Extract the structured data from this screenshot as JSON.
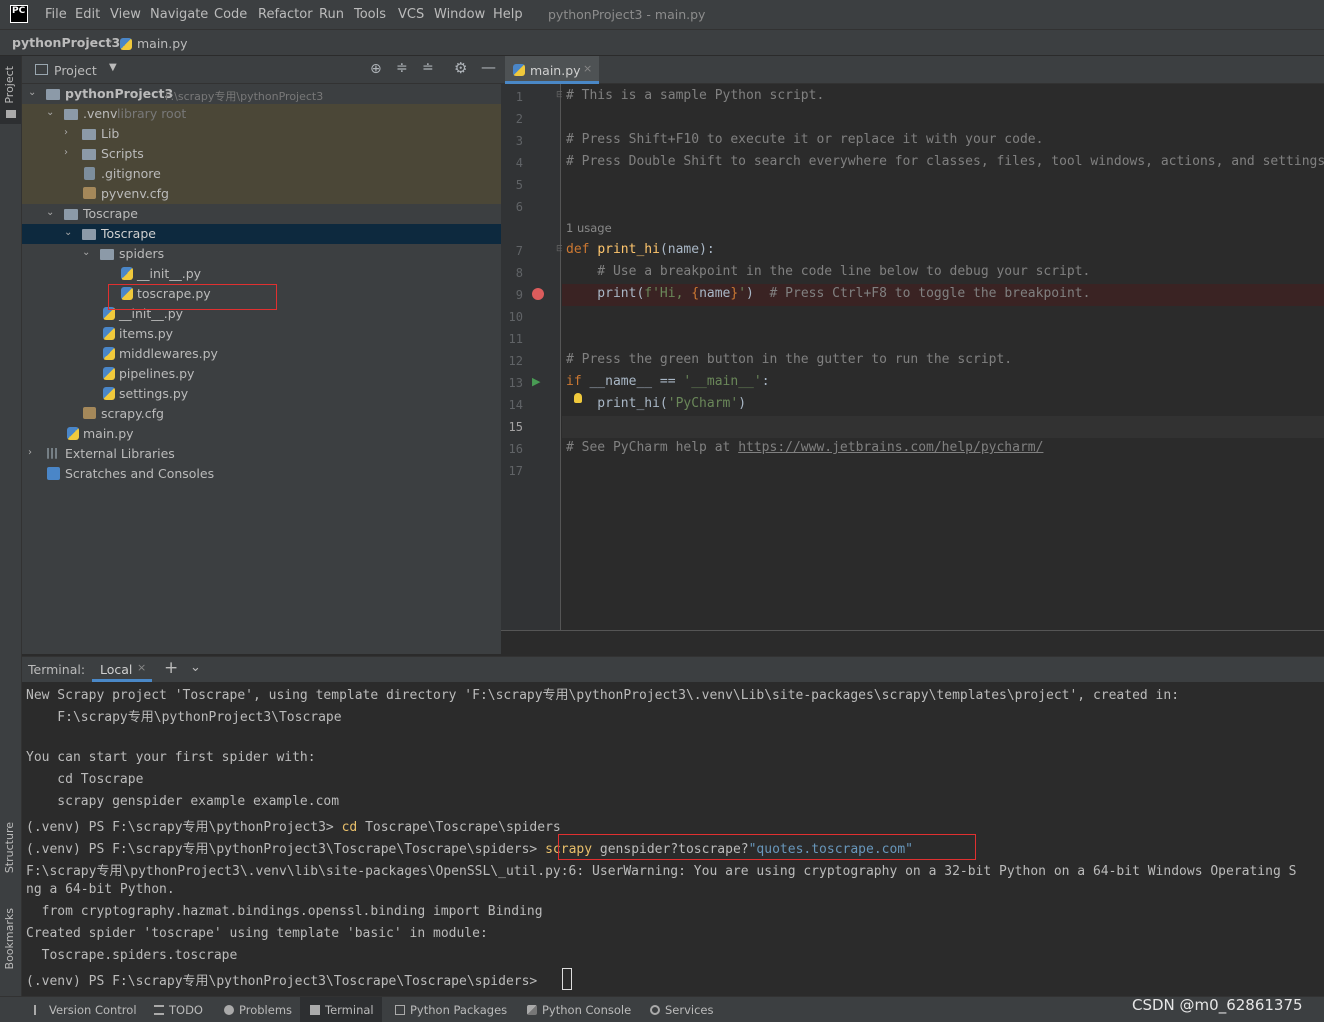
{
  "menubar": {
    "logo": "PC",
    "items": [
      "File",
      "Edit",
      "View",
      "Navigate",
      "Code",
      "Refactor",
      "Run",
      "Tools",
      "VCS",
      "Window",
      "Help"
    ],
    "window_title": "pythonProject3 - main.py"
  },
  "breadcrumb": {
    "project": "pythonProject3",
    "file": "main.py"
  },
  "left_strip": {
    "project_tab": "Project",
    "structure_tab": "Structure",
    "bookmarks_tab": "Bookmarks"
  },
  "project_panel": {
    "title": "Project",
    "tree": [
      {
        "label": "pythonProject3",
        "hint": "F:\\scrapy专用\\pythonProject3"
      },
      {
        "label": ".venv",
        "hint": "library root"
      },
      {
        "label": "Lib"
      },
      {
        "label": "Scripts"
      },
      {
        "label": ".gitignore"
      },
      {
        "label": "pyvenv.cfg"
      },
      {
        "label": "Toscrape"
      },
      {
        "label": "Toscrape"
      },
      {
        "label": "spiders"
      },
      {
        "label": "__init__.py"
      },
      {
        "label": "toscrape.py"
      },
      {
        "label": "__init__.py"
      },
      {
        "label": "items.py"
      },
      {
        "label": "middlewares.py"
      },
      {
        "label": "pipelines.py"
      },
      {
        "label": "settings.py"
      },
      {
        "label": "scrapy.cfg"
      },
      {
        "label": "main.py"
      },
      {
        "label": "External Libraries"
      },
      {
        "label": "Scratches and Consoles"
      }
    ]
  },
  "editor": {
    "tab": "main.py",
    "usage_hint": "1 usage",
    "line_numbers": [
      "1",
      "2",
      "3",
      "4",
      "5",
      "6",
      "7",
      "8",
      "9",
      "10",
      "11",
      "12",
      "13",
      "14",
      "15",
      "16",
      "17"
    ],
    "lines": {
      "l1": "# This is a sample Python script.",
      "l3": "# Press Shift+F10 to execute it or replace it with your code.",
      "l4": "# Press Double Shift to search everywhere for classes, files, tool windows, actions, and settings.",
      "l7_kw": "def ",
      "l7_fn": "print_hi",
      "l7_rest": "(name):",
      "l8": "    # Use a breakpoint in the code line below to debug your script.",
      "l9_a": "    print(",
      "l9_s1": "f'Hi, ",
      "l9_b1": "{",
      "l9_name": "name",
      "l9_b2": "}",
      "l9_s2": "'",
      "l9_c": ")  ",
      "l9_cm": "# Press Ctrl+F8 to toggle the breakpoint.",
      "l12": "# Press the green button in the gutter to run the script.",
      "l13_kw": "if ",
      "l13_a": "__name__ == ",
      "l13_s": "'__main__'",
      "l13_b": ":",
      "l14_a": "    print_hi(",
      "l14_s": "'PyCharm'",
      "l14_b": ")",
      "l16_cm": "# See PyCharm help at ",
      "l16_link": "https://www.jetbrains.com/help/pycharm/"
    }
  },
  "terminal": {
    "label": "Terminal:",
    "tab": "Local",
    "lines": [
      "New Scrapy project 'Toscrape', using template directory 'F:\\scrapy专用\\pythonProject3\\.venv\\Lib\\site-packages\\scrapy\\templates\\project', created in:",
      "    F:\\scrapy专用\\pythonProject3\\Toscrape",
      "",
      "You can start your first spider with:",
      "    cd Toscrape",
      "    scrapy genspider example example.com",
      "(.venv) PS F:\\scrapy专用\\pythonProject3> ",
      "(.venv) PS F:\\scrapy专用\\pythonProject3\\Toscrape\\Toscrape\\spiders> ",
      "F:\\scrapy专用\\pythonProject3\\.venv\\lib\\site-packages\\OpenSSL\\_util.py:6: UserWarning: You are using cryptography on a 32-bit Python on a 64-bit Windows Operating S",
      "ng a 64-bit Python.",
      "  from cryptography.hazmat.bindings.openssl.binding import Binding",
      "Created spider 'toscrape' using template 'basic' in module:",
      "  Toscrape.spiders.toscrape",
      "(.venv) PS F:\\scrapy专用\\pythonProject3\\Toscrape\\Toscrape\\spiders> "
    ],
    "cmd_cd_kw": "cd",
    "cmd_cd_rest": " Toscrape\\Toscrape\\spiders",
    "cmd_gen_kw": "scrapy",
    "cmd_gen_rest": " genspider?toscrape?",
    "cmd_gen_str": "\"quotes.toscrape.com\""
  },
  "statusbar": {
    "items": [
      "Version Control",
      "TODO",
      "Problems",
      "Terminal",
      "Python Packages",
      "Python Console",
      "Services"
    ],
    "watermark": "CSDN @m0_62861375"
  },
  "colors": {
    "accent": "#4a88c7",
    "highlight": "#e03030",
    "selection": "#0d293e"
  }
}
